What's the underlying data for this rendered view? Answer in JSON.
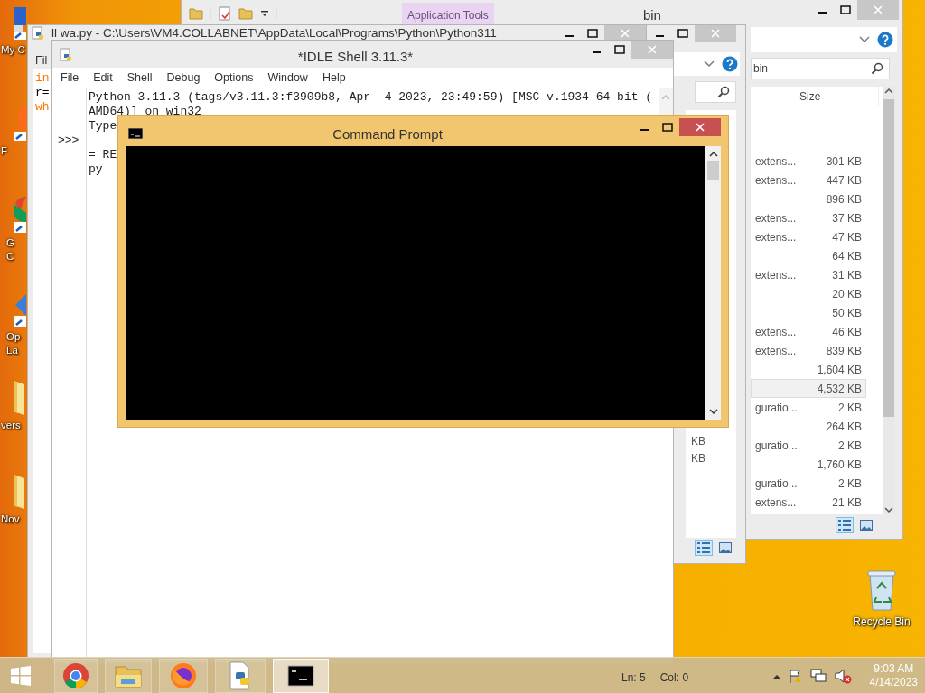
{
  "desktop_icons": [
    {
      "kind": "monitor",
      "lines": [
        "My C"
      ]
    },
    {
      "kind": "fox",
      "lines": [
        "F"
      ]
    },
    {
      "kind": "chrome",
      "lines": [
        "G",
        "C"
      ]
    },
    {
      "kind": "diamond",
      "lines": [
        "Op",
        "La"
      ]
    },
    {
      "kind": "folder",
      "lines": [
        "vers"
      ]
    },
    {
      "kind": "folder",
      "lines": [
        "Nov"
      ]
    }
  ],
  "recycle_bin": {
    "label": "Recycle Bin"
  },
  "explorer": {
    "ribbon_tab": "Application Tools",
    "title": "bin",
    "search": {
      "value": "bin"
    },
    "columns": [
      "Size"
    ],
    "rows": [
      {
        "type": "extens...",
        "size": "301 KB",
        "selected": false
      },
      {
        "type": "extens...",
        "size": "447 KB",
        "selected": false
      },
      {
        "size": "896 KB",
        "selected": false
      },
      {
        "type": "extens...",
        "size": "37 KB",
        "selected": false
      },
      {
        "type": "extens...",
        "size": "47 KB",
        "selected": false
      },
      {
        "size": "64 KB",
        "selected": false
      },
      {
        "type": "extens...",
        "size": "31 KB",
        "selected": false
      },
      {
        "size": "20 KB",
        "selected": false
      },
      {
        "size": "50 KB",
        "selected": false
      },
      {
        "type": "extens...",
        "size": "46 KB",
        "selected": false
      },
      {
        "type": "extens...",
        "size": "839 KB",
        "selected": false
      },
      {
        "size": "1,604 KB",
        "selected": false
      },
      {
        "size": "4,532 KB",
        "selected": true
      },
      {
        "type": "guratio...",
        "size": "2 KB",
        "selected": false
      },
      {
        "size": "264 KB",
        "selected": false
      },
      {
        "type": "guratio...",
        "size": "2 KB",
        "selected": false
      },
      {
        "size": "1,760 KB",
        "selected": false
      },
      {
        "type": "guratio...",
        "size": "2 KB",
        "selected": false
      },
      {
        "type": "extens...",
        "size": "21 KB",
        "selected": false
      }
    ],
    "view_buttons": [
      {
        "kind": "details",
        "selected": true
      },
      {
        "kind": "thumbnails",
        "selected": false
      }
    ]
  },
  "explorer_2": {
    "sizes": [
      "KB",
      "KB"
    ],
    "view_buttons": [
      {
        "kind": "details",
        "selected": true
      },
      {
        "kind": "thumbnails",
        "selected": false
      }
    ]
  },
  "editor": {
    "title": "ll wa.py - C:\\Users\\VM4.COLLABNET\\AppData\\Local\\Programs\\Python\\Python311",
    "menu": [
      "Fil"
    ],
    "code": [
      {
        "text": "in",
        "kind": "keyword"
      },
      {
        "text": "r=",
        "kind": "plain"
      },
      {
        "text": "wh",
        "kind": "keyword"
      }
    ]
  },
  "shell": {
    "title": "*IDLE Shell 3.11.3*",
    "menu": [
      "File",
      "Edit",
      "Shell",
      "Debug",
      "Options",
      "Window",
      "Help"
    ],
    "lines": [
      {
        "text": "Python 3.11.3 (tags/v3.11.3:f3909b8, Apr  4 2023, 23:49:59) [MSC v.1934 64 bit ("
      },
      {
        "text": "AMD64)] on win32"
      },
      {
        "text": "Type"
      },
      {
        "prompt": ">>>"
      },
      {
        "text": "= RE"
      },
      {
        "text": "py"
      }
    ],
    "status": {
      "line": "Ln: 5",
      "column": "Col: 0"
    }
  },
  "console": {
    "title": "Command Prompt",
    "active": true
  },
  "taskbar": {
    "apps": [
      {
        "kind": "chrome",
        "selected": false
      },
      {
        "kind": "explorer",
        "selected": false
      },
      {
        "kind": "firefox",
        "selected": false
      },
      {
        "kind": "python",
        "selected": false
      },
      {
        "kind": "cmd",
        "selected": true
      }
    ],
    "tray": {
      "volume_muted": true
    },
    "clock": {
      "time": "9:03 AM",
      "date": "4/14/2023"
    }
  }
}
